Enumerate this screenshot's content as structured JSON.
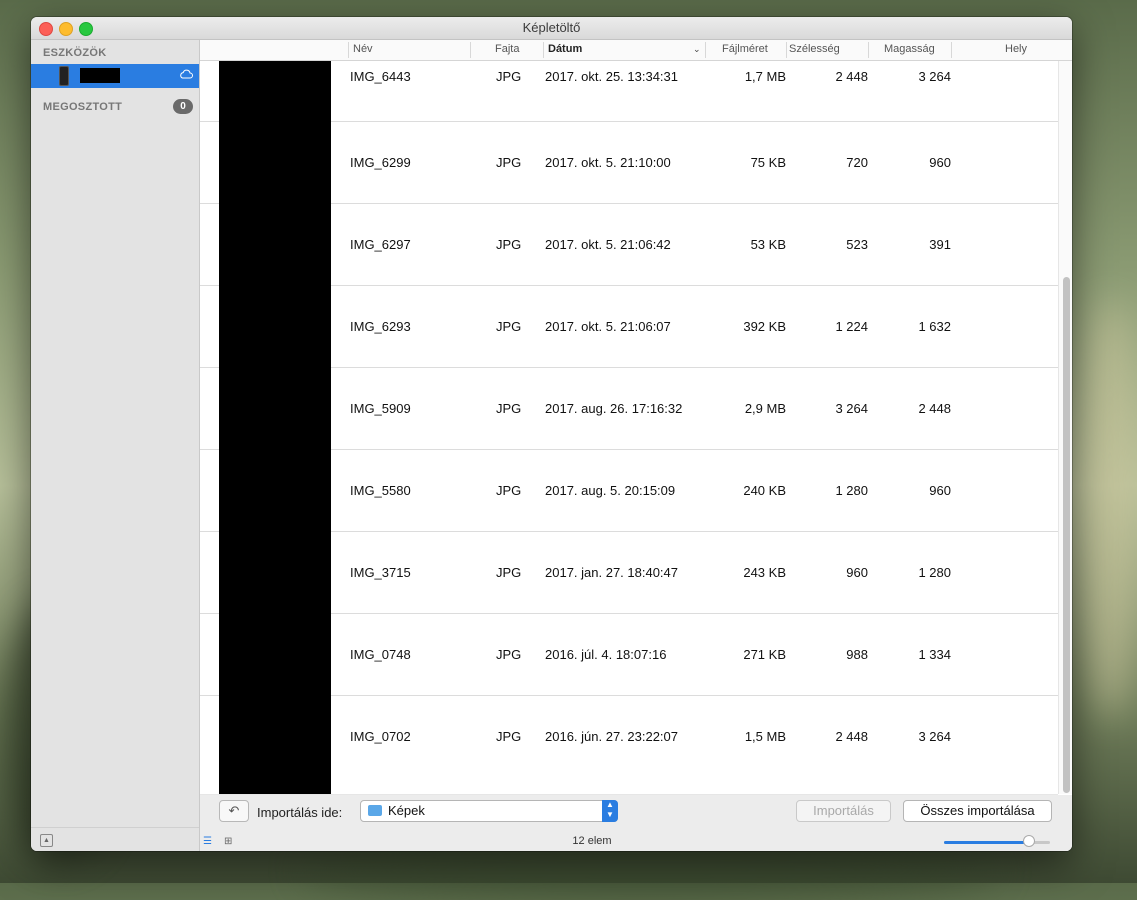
{
  "window": {
    "title": "Képletöltő"
  },
  "sidebar": {
    "devices_header": "ESZKÖZÖK",
    "device_name": "",
    "shared_header": "MEGOSZTOTT",
    "shared_count": "0"
  },
  "columns": {
    "name": "Név",
    "kind": "Fajta",
    "date": "Dátum",
    "size": "Fájlméret",
    "width": "Szélesség",
    "height": "Magasság",
    "location": "Hely"
  },
  "rows": [
    {
      "name": "IMG_6443",
      "kind": "JPG",
      "date": "2017. okt. 25. 13:34:31",
      "size": "1,7 MB",
      "w": "2 448",
      "h": "3 264"
    },
    {
      "name": "IMG_6299",
      "kind": "JPG",
      "date": "2017. okt. 5. 21:10:00",
      "size": "75 KB",
      "w": "720",
      "h": "960"
    },
    {
      "name": "IMG_6297",
      "kind": "JPG",
      "date": "2017. okt. 5. 21:06:42",
      "size": "53 KB",
      "w": "523",
      "h": "391"
    },
    {
      "name": "IMG_6293",
      "kind": "JPG",
      "date": "2017. okt. 5. 21:06:07",
      "size": "392 KB",
      "w": "1 224",
      "h": "1 632"
    },
    {
      "name": "IMG_5909",
      "kind": "JPG",
      "date": "2017. aug. 26. 17:16:32",
      "size": "2,9 MB",
      "w": "3 264",
      "h": "2 448"
    },
    {
      "name": "IMG_5580",
      "kind": "JPG",
      "date": "2017. aug. 5. 20:15:09",
      "size": "240 KB",
      "w": "1 280",
      "h": "960"
    },
    {
      "name": "IMG_3715",
      "kind": "JPG",
      "date": "2017. jan. 27. 18:40:47",
      "size": "243 KB",
      "w": "960",
      "h": "1 280"
    },
    {
      "name": "IMG_0748",
      "kind": "JPG",
      "date": "2016. júl. 4. 18:07:16",
      "size": "271 KB",
      "w": "988",
      "h": "1 334"
    },
    {
      "name": "IMG_0702",
      "kind": "JPG",
      "date": "2016. jún. 27. 23:22:07",
      "size": "1,5 MB",
      "w": "2 448",
      "h": "3 264"
    }
  ],
  "toolbar": {
    "import_to_label": "Importálás ide:",
    "destination": "Képek",
    "import_button": "Importálás",
    "import_all_button": "Összes importálása"
  },
  "status": {
    "item_count": "12 elem"
  },
  "zoom": {
    "level": 0.8
  },
  "colors": {
    "accent": "#2a7de1",
    "badge": "#6a6a6a"
  }
}
